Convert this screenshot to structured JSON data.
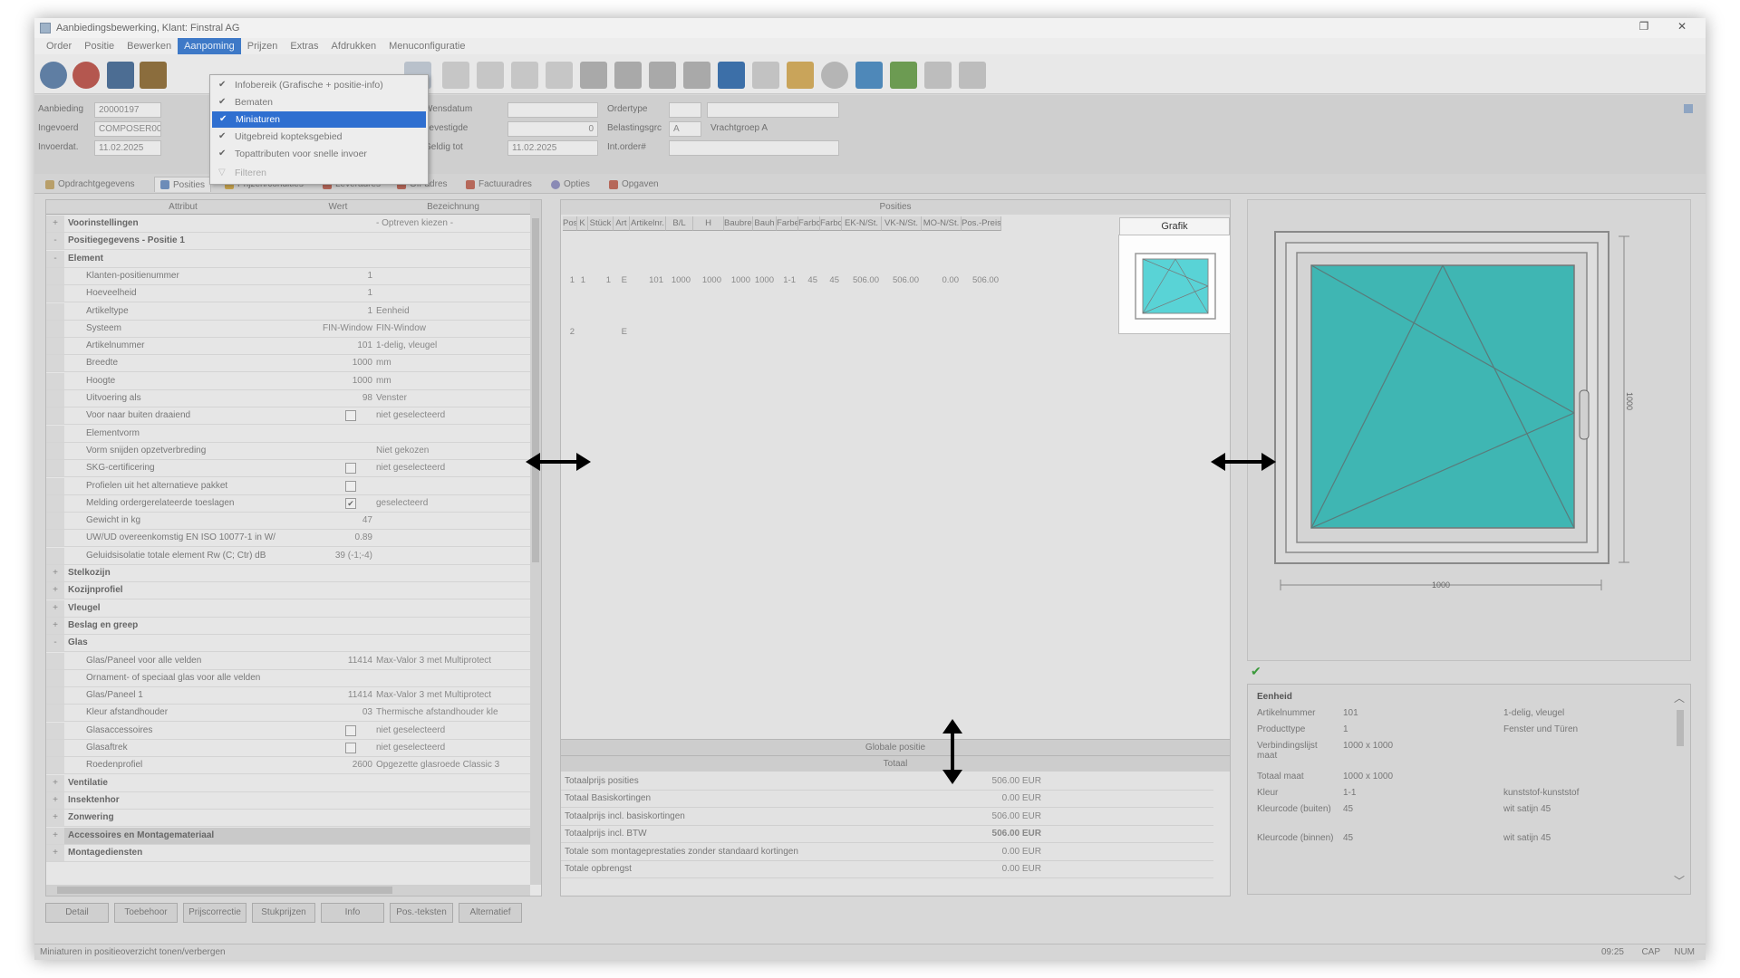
{
  "window": {
    "title": "Aanbiedingsbewerking, Klant: Finstral AG"
  },
  "menu": [
    "Order",
    "Positie",
    "Bewerken",
    "Aanpoming",
    "Prijzen",
    "Extras",
    "Afdrukken",
    "Menuconfiguratie"
  ],
  "dropdown": {
    "items": [
      {
        "label": "Infobereik (Grafische + positie-info)",
        "checked": "✔"
      },
      {
        "label": "Bematen",
        "checked": "✔"
      },
      {
        "label": "Miniaturen",
        "checked": "✔"
      },
      {
        "label": "Uitgebreid kopteksgebied",
        "checked": "✔"
      },
      {
        "label": "Topattributen voor snelle invoer",
        "checked": "✔"
      },
      {
        "label": "Filteren",
        "checked": "▽"
      }
    ]
  },
  "header": {
    "aanbieding_label": "Aanbieding",
    "aanbieding_value": "20000197",
    "ingevoerd_label": "Ingevoerd",
    "ingevoerd_value": "COMPOSER0001",
    "invoerdat_label": "Invoerdat.",
    "invoerdat_value": "11.02.2025",
    "wensdatum_label": "Wensdatum",
    "wensdatum_value": "",
    "bevestigde_label": "bevestigde",
    "bevestigde_value": "0",
    "geldig_label": "Geldig tot",
    "geldig_value": "11.02.2025",
    "ordertype_label": "Ordertype",
    "ordertype_value": "",
    "belasting_label": "Belastingsgrc",
    "belasting_value": "A",
    "belasting_desc": "Vrachtgroep A",
    "int_order_label": "Int.order#",
    "int_order_value": ""
  },
  "tabs": [
    "Opdrachtgegevens",
    "Posities",
    "Prijzen/condities",
    "Leveradres",
    "Off-adres",
    "Factuuradres",
    "Opties",
    "Opgaven"
  ],
  "attributes": {
    "columns": [
      "Attribut",
      "Wert",
      "Bezeichnung"
    ],
    "rows": [
      {
        "type": "group",
        "label": "Voorinstellingen",
        "value": "",
        "desc": "- Optreven kiezen -",
        "ex": "+"
      },
      {
        "type": "group",
        "label": "Positiegegevens - Positie 1",
        "value": "",
        "desc": "",
        "ex": "-"
      },
      {
        "type": "group",
        "label": "Element",
        "value": "",
        "desc": "",
        "ex": "-"
      },
      {
        "type": "row",
        "label": "Klanten-positienummer",
        "value": "1",
        "desc": ""
      },
      {
        "type": "row",
        "label": "Hoeveelheid",
        "value": "1",
        "desc": ""
      },
      {
        "type": "row",
        "label": "Artikeltype",
        "value": "1",
        "desc": "Eenheid"
      },
      {
        "type": "row",
        "label": "Systeem",
        "value": "FIN-Window",
        "desc": "FIN-Window"
      },
      {
        "type": "row",
        "label": "Artikelnummer",
        "value": "101",
        "desc": "1-delig, vleugel"
      },
      {
        "type": "row",
        "label": "Breedte",
        "value": "1000",
        "desc": "mm"
      },
      {
        "type": "row",
        "label": "Hoogte",
        "value": "1000",
        "desc": "mm"
      },
      {
        "type": "row",
        "label": "Uitvoering als",
        "value": "98",
        "desc": "Venster"
      },
      {
        "type": "check",
        "label": "Voor naar buiten draaiend",
        "checked": "",
        "desc": "niet geselecteerd"
      },
      {
        "type": "row",
        "label": "Elementvorm",
        "value": "",
        "desc": ""
      },
      {
        "type": "row",
        "label": "Vorm snijden opzetverbreding",
        "value": "",
        "desc": "Niet gekozen"
      },
      {
        "type": "check",
        "label": "SKG-certificering",
        "checked": "",
        "desc": "niet geselecteerd"
      },
      {
        "type": "check",
        "label": "Profielen uit het alternatieve pakket",
        "checked": "",
        "desc": ""
      },
      {
        "type": "check",
        "label": "Melding ordergerelateerde toeslagen",
        "checked": "✔",
        "desc": "geselecteerd"
      },
      {
        "type": "row",
        "label": "Gewicht in kg",
        "value": "47",
        "desc": ""
      },
      {
        "type": "row",
        "label": "UW/UD overeenkomstig EN ISO 10077-1 in W/",
        "value": "0.89",
        "desc": ""
      },
      {
        "type": "row",
        "label": "Geluidsisolatie totale element Rw (C; Ctr) dB",
        "value": "39 (-1;-4)",
        "desc": ""
      },
      {
        "type": "group",
        "label": "Stelkozijn",
        "value": "",
        "desc": "",
        "ex": "+"
      },
      {
        "type": "group",
        "label": "Kozijnprofiel",
        "value": "",
        "desc": "",
        "ex": "+"
      },
      {
        "type": "group",
        "label": "Vleugel",
        "value": "",
        "desc": "",
        "ex": "+"
      },
      {
        "type": "group",
        "label": "Beslag en greep",
        "value": "",
        "desc": "",
        "ex": "+"
      },
      {
        "type": "group",
        "label": "Glas",
        "value": "",
        "desc": "",
        "ex": "-"
      },
      {
        "type": "row",
        "label": "Glas/Paneel voor alle velden",
        "value": "11414",
        "desc": "Max-Valor 3 met Multiprotect"
      },
      {
        "type": "row",
        "label": "Ornament- of speciaal glas voor alle velden",
        "value": "",
        "desc": ""
      },
      {
        "type": "row",
        "label": "Glas/Paneel 1",
        "value": "11414",
        "desc": "Max-Valor 3 met Multiprotect"
      },
      {
        "type": "row",
        "label": "Kleur afstandhouder",
        "value": "03",
        "desc": "Thermische afstandhouder kle"
      },
      {
        "type": "check",
        "label": "Glasaccessoires",
        "checked": "",
        "desc": "niet geselecteerd"
      },
      {
        "type": "check",
        "label": "Glasaftrek",
        "checked": "",
        "desc": "niet geselecteerd"
      },
      {
        "type": "row",
        "label": "Roedenprofiel",
        "value": "2600",
        "desc": "Opgezette glasroede Classic 3"
      },
      {
        "type": "group",
        "label": "Ventilatie",
        "value": "",
        "desc": "",
        "ex": "+"
      },
      {
        "type": "group",
        "label": "Insektenhor",
        "value": "",
        "desc": "",
        "ex": "+"
      },
      {
        "type": "group",
        "label": "Zonwering",
        "value": "",
        "desc": "",
        "ex": "+"
      },
      {
        "type": "group",
        "label": "Accessoires en Montagemateriaal",
        "value": "",
        "desc": "",
        "ex": "+"
      },
      {
        "type": "group",
        "label": "Montagediensten",
        "value": "",
        "desc": "",
        "ex": "+"
      }
    ]
  },
  "positions": {
    "title": "Posities",
    "columns": [
      "Pos",
      "K",
      "Stück",
      "Art",
      "Artikelnr.",
      "B/L",
      "H",
      "Baubrei",
      "Bauh",
      "Farbe",
      "Farbc",
      "Farbc",
      "EK-N/St.",
      "VK-N/St.",
      "MO-N/St.",
      "Pos.-Preis"
    ],
    "row1": [
      "1",
      "1",
      "1",
      "E",
      "101",
      "1000",
      "1000",
      "1000",
      "1000",
      "1-1",
      "45",
      "45",
      "506.00",
      "506.00",
      "0.00",
      "506.00"
    ],
    "row2": [
      "2",
      "",
      "",
      "E"
    ],
    "grafik_label": "Grafik",
    "global_label": "Globale positie",
    "total_label": "Totaal",
    "totals": [
      {
        "label": "Totaalprijs posities",
        "value": "506.00 EUR"
      },
      {
        "label": "Totaal Basiskortingen",
        "value": "0.00 EUR"
      },
      {
        "label": "Totaalprijs incl. basiskortingen",
        "value": "506.00 EUR"
      },
      {
        "label": "Totaalprijs incl. BTW",
        "value": "506.00 EUR"
      },
      {
        "label": "Totale som montageprestaties zonder standaard kortingen",
        "value": "0.00 EUR"
      },
      {
        "label": "Totale opbrengst",
        "value": "0.00 EUR"
      }
    ]
  },
  "preview": {
    "width_label": "1000",
    "height_label": "1000",
    "glass_color": "#3fb6b3"
  },
  "info": {
    "title": "Eenheid",
    "rows": [
      {
        "k": "Artikelnummer",
        "v": "101",
        "d": "1-delig, vleugel"
      },
      {
        "k": "Producttype",
        "v": "1",
        "d": "Fenster und Türen"
      },
      {
        "k": "Verbindingslijst maat",
        "v": "1000 x 1000",
        "d": ""
      },
      {
        "k": "Totaal maat",
        "v": "1000 x 1000",
        "d": ""
      },
      {
        "k": "Kleur",
        "v": "1-1",
        "d": "kunststof-kunststof"
      },
      {
        "k": "Kleurcode (buiten)",
        "v": "45",
        "d": "wit satijn 45"
      },
      {
        "k": "Kleurcode (binnen)",
        "v": "45",
        "d": "wit satijn 45"
      }
    ]
  },
  "buttons": [
    "Detail",
    "Toebehoor",
    "Prijscorrectie",
    "Stukprijzen",
    "Info",
    "Pos.-teksten",
    "Alternatief"
  ],
  "status": {
    "text": "Miniaturen in positieoverzicht tonen/verbergen",
    "time": "09:25",
    "caps": "CAP",
    "num": "NUM"
  }
}
